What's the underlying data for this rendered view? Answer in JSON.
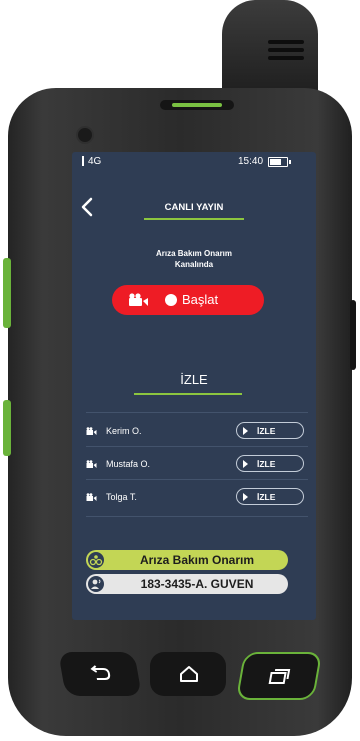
{
  "status_bar": {
    "network": "4G",
    "time": "15:40"
  },
  "header": {
    "title": "CANLI YAYIN"
  },
  "channel": {
    "line1": "Arıza Bakım Onarım",
    "line2": "Kanalında"
  },
  "start_button": {
    "label": "Başlat"
  },
  "watch": {
    "heading": "İZLE",
    "items": [
      {
        "name": "Kerim O.",
        "button": "İZLE"
      },
      {
        "name": "Mustafa O.",
        "button": "İZLE"
      },
      {
        "name": "Tolga T.",
        "button": "İZLE"
      }
    ]
  },
  "footer": {
    "channel_name": "Arıza Bakım Onarım",
    "user": "183-3435-A. GUVEN"
  },
  "colors": {
    "screen_bg": "#2f3d54",
    "accent_green": "#8cc63f",
    "record_red": "#ee1c25"
  }
}
